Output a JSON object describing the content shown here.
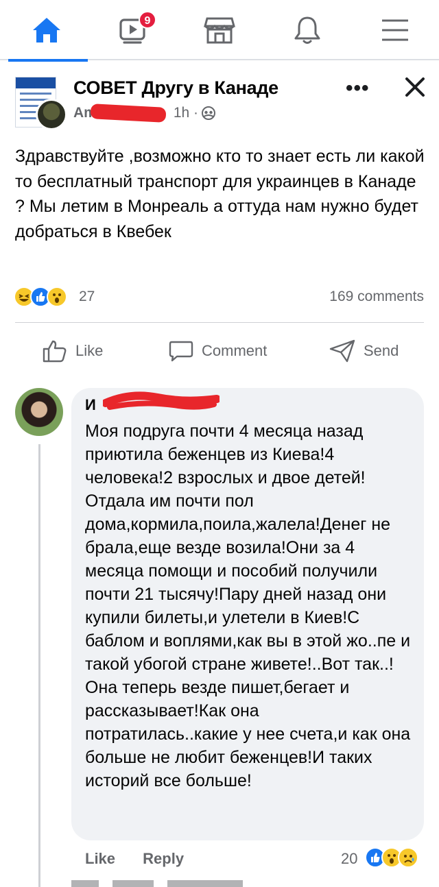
{
  "nav": {
    "items": [
      {
        "icon": "home-icon",
        "active": true
      },
      {
        "icon": "video-icon",
        "badge": "9"
      },
      {
        "icon": "marketplace-icon"
      },
      {
        "icon": "bell-icon"
      },
      {
        "icon": "menu-icon"
      }
    ],
    "accent": "#1877f2"
  },
  "post": {
    "group_name": "СОВЕТ Другу в Канаде",
    "author": "Am",
    "time": "1h ·",
    "audience_icon": "group-audience-icon",
    "text": "Здравствуйте ,возможно кто то знает есть ли какой то бесплатный транспорт для украинцев в Канаде ? Мы летим в Монреаль а оттуда нам нужно будет добраться в Квебек",
    "reactions": [
      "haha",
      "like",
      "wow"
    ],
    "reaction_count": "27",
    "comments_count": "169 comments"
  },
  "actions": {
    "like": "Like",
    "comment": "Comment",
    "send": "Send"
  },
  "comment": {
    "author": "И",
    "text": "Моя подруга почти 4 месяца назад приютила беженцев из Киева!4 человека!2 взрослых и двое детей! Отдала им почти пол дома,кормила,поила,жалела!Денег не брала,еще везде возила!Они за 4 месяца помощи и пособий получили почти 21 тысячу!Пару дней назад они купили билеты,и улетели в Киев!С баблом и воплями,как вы в этой жо..пе и такой убогой  стране живете!..Вот так..!Она теперь везде пишет,бегает и рассказывает!Как она потратилась..какие у нее счета,и как она больше не любит беженцев!И таких историй все больше!",
    "like_label": "Like",
    "reply_label": "Reply",
    "reaction_count": "20",
    "reactions": [
      "like",
      "wow",
      "sad"
    ]
  }
}
